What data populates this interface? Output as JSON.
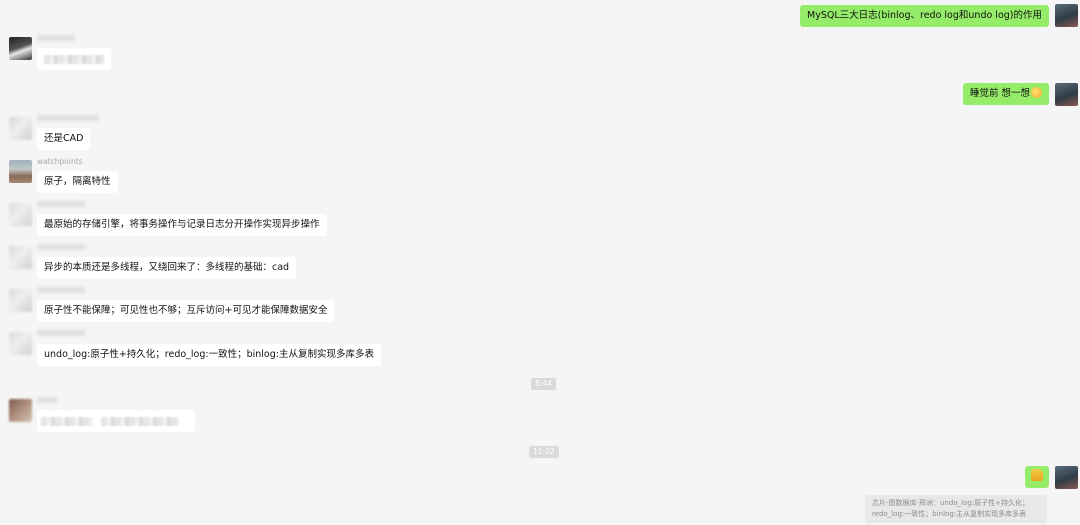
{
  "messages": {
    "m1_right": "MySQL三大日志(binlog、redo log和undo log)的作用",
    "m3_right": "睡觉前 想一想",
    "m4_left": "还是CAD",
    "m5_name": "watchpoints",
    "m5_left": "原子，隔离特性",
    "m6_left": "最原始的存储引擎，将事务操作与记录日志分开操作实现异步操作",
    "m7_left": "异步的本质还是多线程，又绕回来了：多线程的基础：cad",
    "m8_left": "原子性不能保障；可见性也不够；互斥访问+可见才能保障数据安全",
    "m9_left": "undo_log:原子性+持久化；redo_log:一致性；binlog:主从复制实现多库多表"
  },
  "timestamps": {
    "t1": "8:44",
    "t2": "11:02"
  },
  "quote": {
    "line1": "芯片-图数据库-邢洲：undo_log:原子性+持久化；",
    "line2": "redo_log:一致性；binlog:主从复制实现多库多表"
  },
  "icons": {
    "emoji": "grinning-face-icon",
    "thumbs_up": "thumbs-up-icon"
  },
  "colors": {
    "background": "#f5f5f5",
    "bubble_self": "#95ec69",
    "bubble_other": "#ffffff",
    "timestamp_bg": "#dadada"
  }
}
